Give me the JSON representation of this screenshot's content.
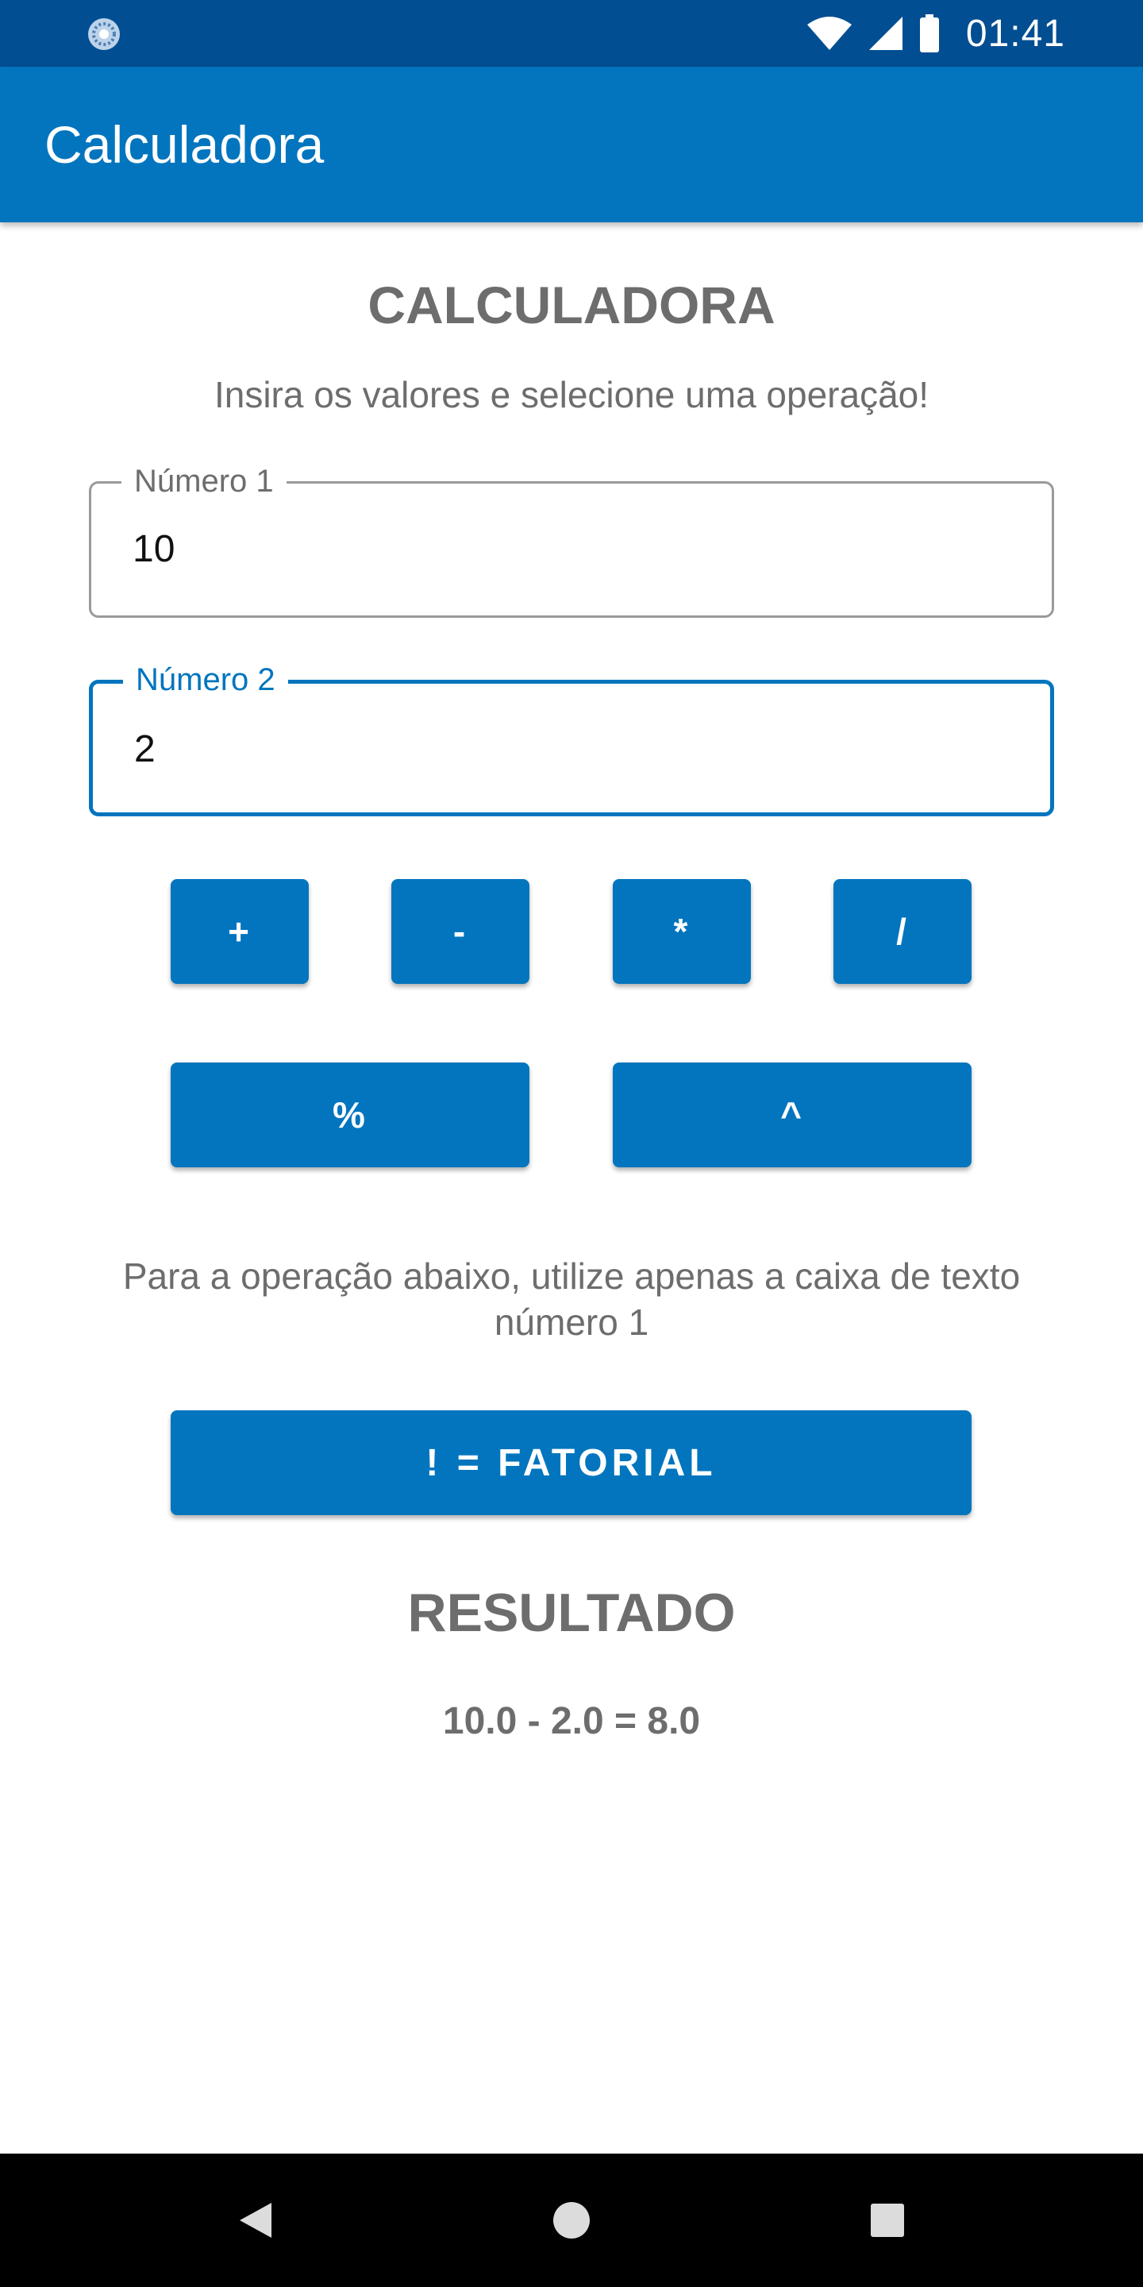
{
  "status_bar": {
    "time": "01:41",
    "icons": [
      "app-notification-icon",
      "wifi-icon",
      "signal-icon",
      "battery-icon"
    ]
  },
  "app_bar": {
    "title": "Calculadora"
  },
  "main": {
    "heading": "CALCULADORA",
    "subtitle": "Insira os valores e selecione uma operação!",
    "field1": {
      "label": "Número 1",
      "value": "10"
    },
    "field2": {
      "label": "Número 2",
      "value": "2"
    },
    "operations": {
      "add": "+",
      "subtract": "-",
      "multiply": "*",
      "divide": "/",
      "modulo": "%",
      "power": "^"
    },
    "note": "Para a operação abaixo, utilize apenas a caixa de texto número 1",
    "factorial_label": "! = FATORIAL",
    "result_heading": "RESULTADO",
    "result_value": "10.0 - 2.0 = 8.0"
  },
  "nav_bar": {
    "icons": [
      "back-icon",
      "home-icon",
      "recents-icon"
    ]
  },
  "colors": {
    "status_bar": "#014e92",
    "primary": "#0275be",
    "text_gray": "#6d6d6d",
    "field_border": "#9a9a9a"
  }
}
